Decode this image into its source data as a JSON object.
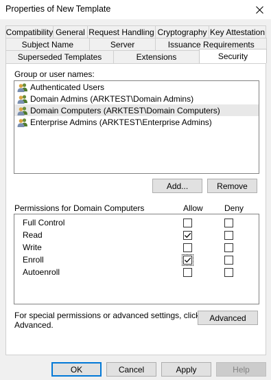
{
  "window": {
    "title": "Properties of New Template"
  },
  "tabs": {
    "row1": [
      "Compatibility",
      "General",
      "Request Handling",
      "Cryptography",
      "Key Attestation"
    ],
    "row2": [
      "Subject Name",
      "Server",
      "Issuance Requirements"
    ],
    "row3": [
      "Superseded Templates",
      "Extensions",
      "Security"
    ],
    "active": "Security"
  },
  "security": {
    "group_label": "Group or user names:",
    "users": [
      {
        "name": "Authenticated Users",
        "selected": false
      },
      {
        "name": "Domain Admins (ARKTEST\\Domain Admins)",
        "selected": false
      },
      {
        "name": "Domain Computers (ARKTEST\\Domain Computers)",
        "selected": true
      },
      {
        "name": "Enterprise Admins (ARKTEST\\Enterprise Admins)",
        "selected": false
      }
    ],
    "add_label": "Add...",
    "remove_label": "Remove",
    "perm_label": "Permissions for Domain Computers",
    "allow_header": "Allow",
    "deny_header": "Deny",
    "permissions": [
      {
        "name": "Full Control",
        "allow": false,
        "deny": false
      },
      {
        "name": "Read",
        "allow": true,
        "deny": false
      },
      {
        "name": "Write",
        "allow": false,
        "deny": false
      },
      {
        "name": "Enroll",
        "allow": true,
        "deny": false
      },
      {
        "name": "Autoenroll",
        "allow": false,
        "deny": false
      }
    ],
    "advanced_text_1": "For special permissions or advanced settings, click",
    "advanced_text_2": "Advanced.",
    "advanced_label": "Advanced"
  },
  "footer": {
    "ok": "OK",
    "cancel": "Cancel",
    "apply": "Apply",
    "help": "Help"
  },
  "colors": {
    "accent": "#0078d7",
    "window_bg": "#f0f0f0"
  }
}
